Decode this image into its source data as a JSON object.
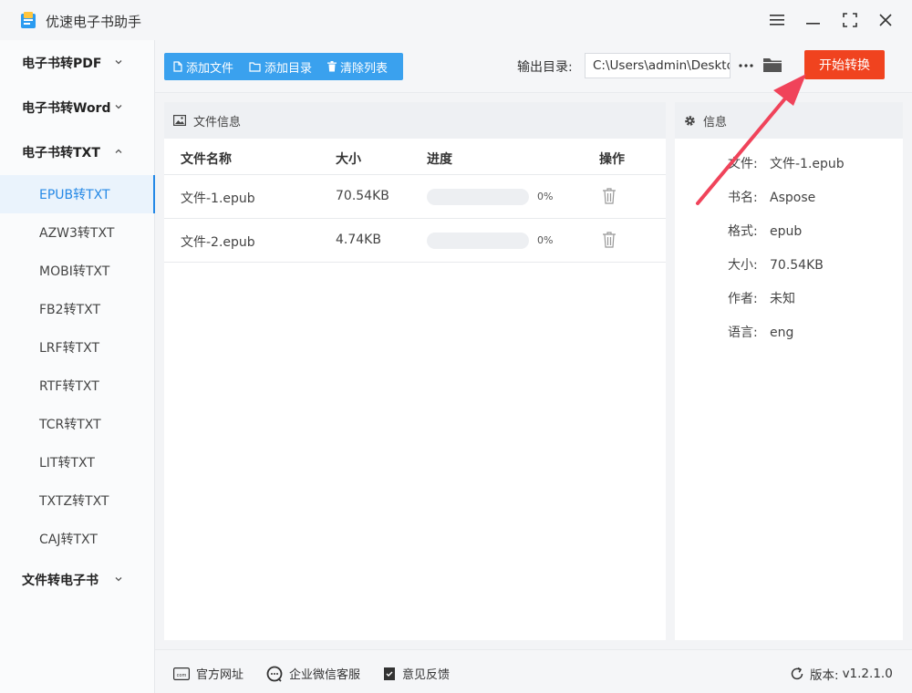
{
  "app": {
    "title": "优速电子书助手"
  },
  "sidebar": {
    "groups": [
      {
        "label": "电子书转PDF"
      },
      {
        "label": "电子书转Word"
      },
      {
        "label": "电子书转TXT"
      },
      {
        "label": "文件转电子书"
      }
    ],
    "txt_items": [
      "EPUB转TXT",
      "AZW3转TXT",
      "MOBI转TXT",
      "FB2转TXT",
      "LRF转TXT",
      "RTF转TXT",
      "TCR转TXT",
      "LIT转TXT",
      "TXTZ转TXT",
      "CAJ转TXT"
    ],
    "active_item": "EPUB转TXT"
  },
  "toolbar": {
    "add_file": "添加文件",
    "add_dir": "添加目录",
    "clear_list": "清除列表",
    "output_label": "输出目录:",
    "output_path": "C:\\Users\\admin\\Desktop",
    "start": "开始转换"
  },
  "file_panel": {
    "title": "文件信息",
    "columns": [
      "文件名称",
      "大小",
      "进度",
      "操作"
    ],
    "rows": [
      {
        "name": "文件-1.epub",
        "size": "70.54KB",
        "progress": 0,
        "progress_text": "0%"
      },
      {
        "name": "文件-2.epub",
        "size": "4.74KB",
        "progress": 0,
        "progress_text": "0%"
      }
    ]
  },
  "info_panel": {
    "title": "信息",
    "rows": [
      {
        "key": "文件:",
        "value": "文件-1.epub"
      },
      {
        "key": "书名:",
        "value": "Aspose"
      },
      {
        "key": "格式:",
        "value": "epub"
      },
      {
        "key": "大小:",
        "value": "70.54KB"
      },
      {
        "key": "作者:",
        "value": "未知"
      },
      {
        "key": "语言:",
        "value": "eng"
      }
    ]
  },
  "statusbar": {
    "website": "官方网址",
    "wechat": "企业微信客服",
    "feedback": "意见反馈",
    "version_label": "版本:",
    "version": "v1.2.1.0"
  },
  "colors": {
    "accent": "#3aa1ee",
    "start_button": "#f0431f",
    "annotation_arrow": "#f0435a"
  }
}
